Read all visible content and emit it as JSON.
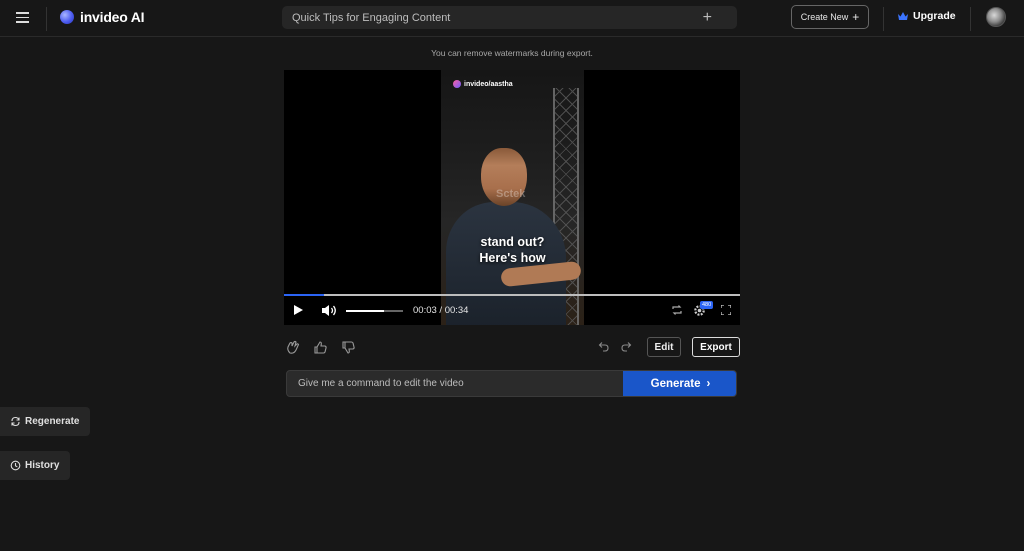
{
  "header": {
    "brand": "invideo AI",
    "search_text": "Quick Tips for Engaging Content",
    "create_new_label": "Create New",
    "upgrade_label": "Upgrade"
  },
  "notice": "You can remove watermarks during export.",
  "video": {
    "watermark_handle": "invideo/aastha",
    "caption_line1": "stand out?",
    "caption_line2": "Here's how",
    "background_sign": "Sctek",
    "current_time": "00:03",
    "total_time": "00:34",
    "time_display": "00:03 / 00:34",
    "progress_fraction": 0.088,
    "volume_fraction": 0.66,
    "quality_badge": "480"
  },
  "actions": {
    "edit_label": "Edit",
    "export_label": "Export"
  },
  "command": {
    "placeholder": "Give me a command to edit the video",
    "generate_label": "Generate",
    "generate_arrow": "›"
  },
  "sidebar": {
    "regenerate_label": "Regenerate",
    "history_label": "History"
  },
  "icons": {
    "menu": "hamburger-icon",
    "plus": "plus-icon",
    "crown": "crown-icon",
    "play": "play-icon",
    "volume": "volume-icon",
    "loop": "loop-icon",
    "gear": "gear-icon",
    "fullscreen": "fullscreen-icon",
    "clap": "clap-icon",
    "thumbs_up": "thumbs-up-icon",
    "thumbs_down": "thumbs-down-icon",
    "undo": "undo-icon",
    "redo": "redo-icon",
    "refresh": "refresh-icon",
    "clock": "clock-icon"
  },
  "colors": {
    "background": "#171717",
    "accent_blue": "#1a56c9",
    "progress_blue": "#2b64f5"
  }
}
